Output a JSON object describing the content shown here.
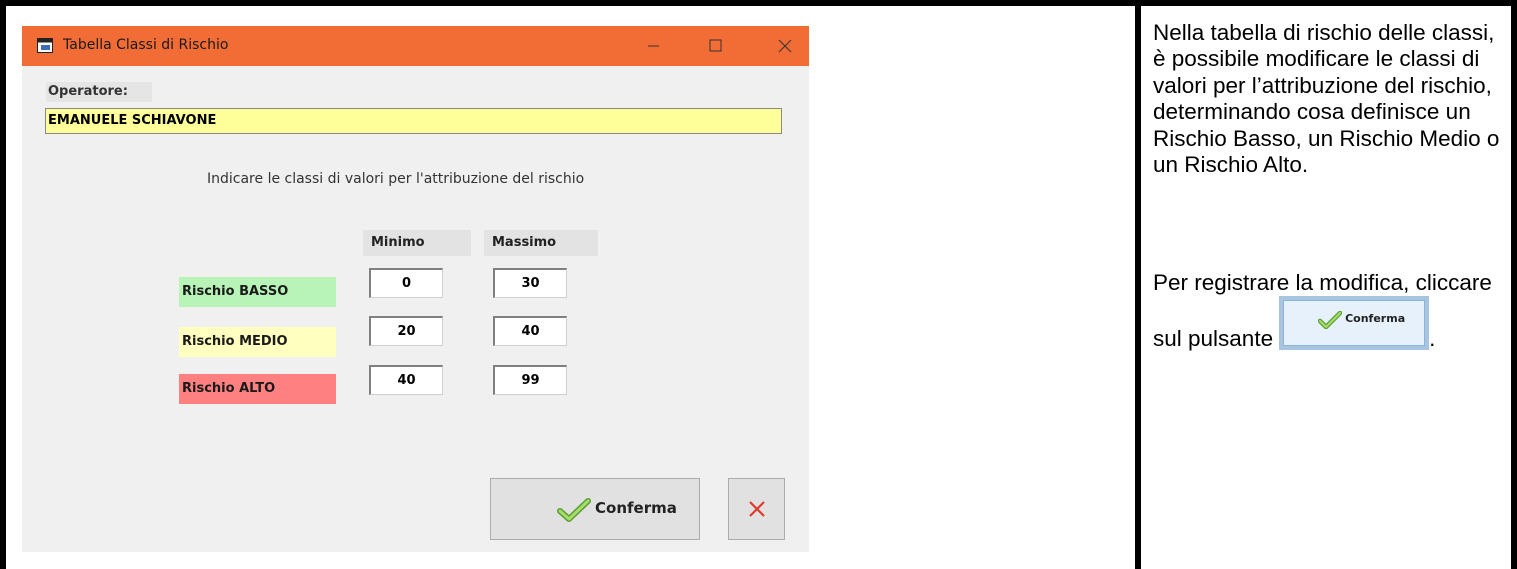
{
  "window": {
    "title": "Tabella Classi di Rischio",
    "titlebar_color": "#f26c36",
    "controls": [
      "minimize-icon",
      "maximize-icon",
      "close-icon"
    ]
  },
  "operator": {
    "label": "Operatore:",
    "value": "EMANUELE SCHIAVONE",
    "field_color": "#ffff99"
  },
  "instruction": "Indicare le classi di valori per l'attribuzione del rischio",
  "table": {
    "headers": {
      "min": "Minimo",
      "max": "Massimo"
    },
    "rows": [
      {
        "label": "Rischio BASSO",
        "min": "0",
        "max": "30",
        "color": "#b8f4b8"
      },
      {
        "label": "Rischio MEDIO",
        "min": "20",
        "max": "40",
        "color": "#ffffc0"
      },
      {
        "label": "Rischio ALTO",
        "min": "40",
        "max": "99",
        "color": "#ff8080"
      }
    ]
  },
  "buttons": {
    "confirm": "Conferma",
    "confirm_icon": "check-icon",
    "cancel_icon": "x-icon"
  },
  "sidebar": {
    "paragraph1": "Nella tabella di rischio delle classi, è possibile modificare le classi di valori per l’attribuzione del rischio, determinando cosa definisce un Rischio Basso, un Rischio Medio o un Rischio Alto.",
    "paragraph2_lead": "Per registrare la modifica, cliccare sul pulsante",
    "paragraph2_end": ".",
    "button_label": "Conferma"
  }
}
